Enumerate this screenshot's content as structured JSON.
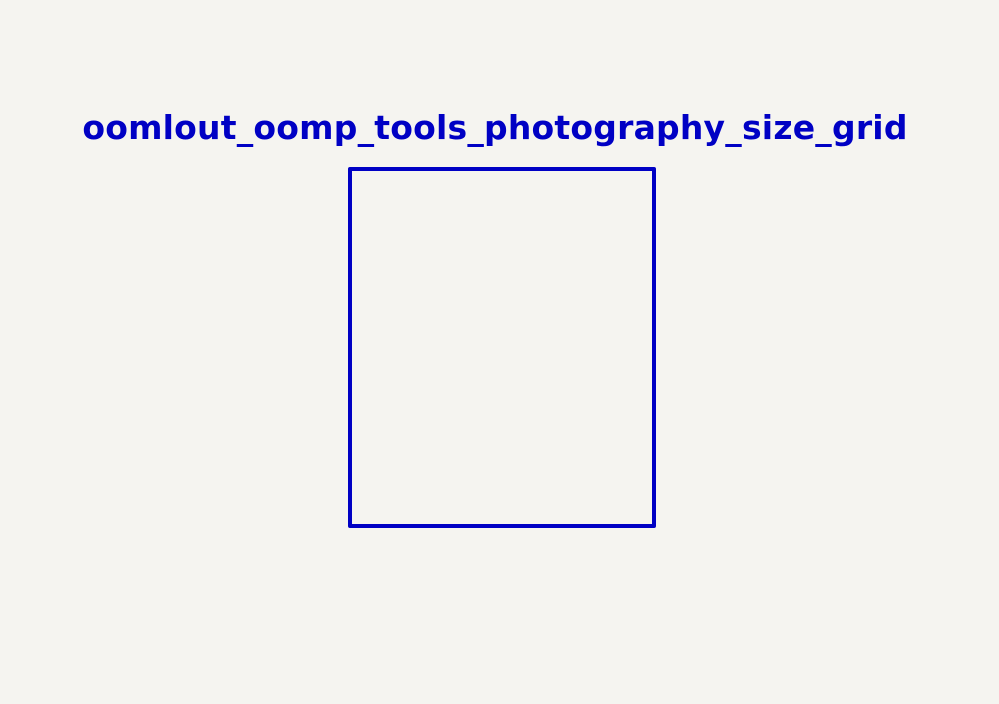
{
  "symbol": {
    "title": "oomlout_oomp_tools_photography_size_grid"
  },
  "colors": {
    "background": "#f5f4f0",
    "stroke": "#0000c4"
  }
}
